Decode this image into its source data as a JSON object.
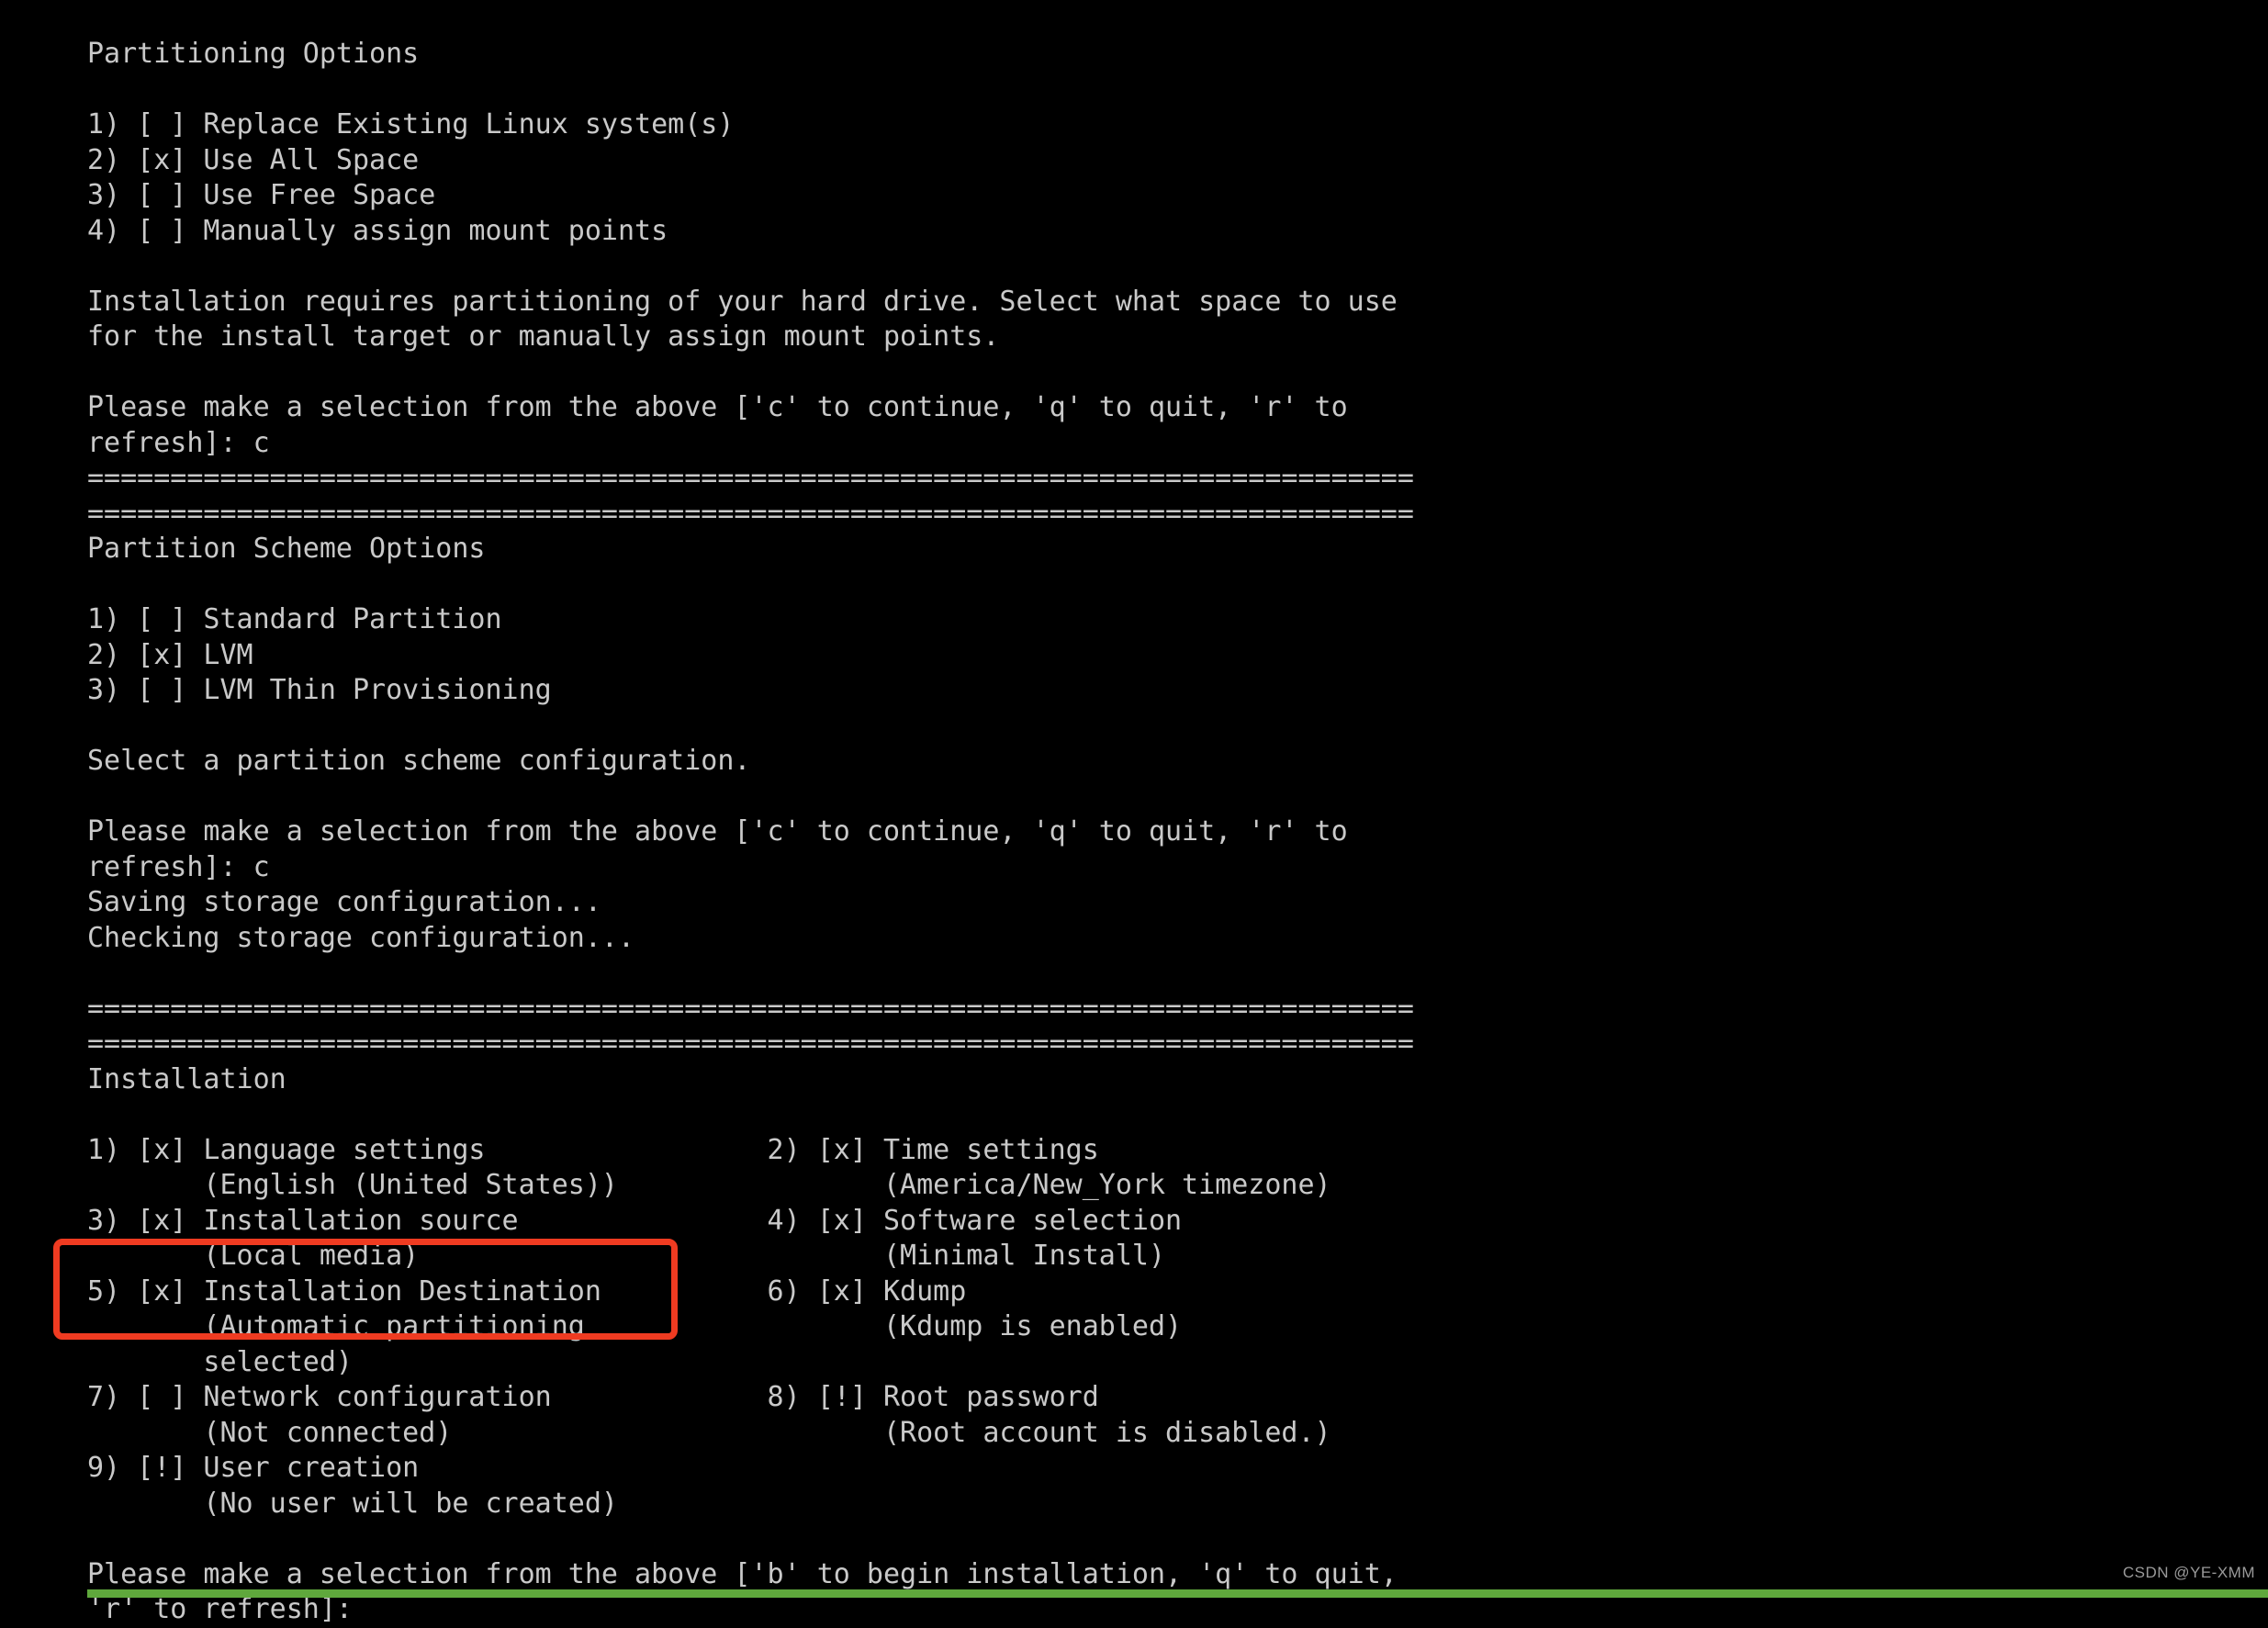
{
  "terminal": {
    "background_color": "#000000",
    "text_color": "#c9c9c9",
    "highlight_color": "#ef3b21",
    "strip_color": "#5fa83c",
    "separator": "================================================================================",
    "lines": [
      "Partitioning Options",
      "",
      "1) [ ] Replace Existing Linux system(s)",
      "2) [x] Use All Space",
      "3) [ ] Use Free Space",
      "4) [ ] Manually assign mount points",
      "",
      "Installation requires partitioning of your hard drive. Select what space to use",
      "for the install target or manually assign mount points.",
      "",
      "Please make a selection from the above ['c' to continue, 'q' to quit, 'r' to",
      "refresh]: c",
      "================================================================================",
      "================================================================================",
      "Partition Scheme Options",
      "",
      "1) [ ] Standard Partition",
      "2) [x] LVM",
      "3) [ ] LVM Thin Provisioning",
      "",
      "Select a partition scheme configuration.",
      "",
      "Please make a selection from the above ['c' to continue, 'q' to quit, 'r' to",
      "refresh]: c",
      "Saving storage configuration...",
      "Checking storage configuration...",
      "",
      "================================================================================",
      "================================================================================",
      "Installation",
      "",
      "1) [x] Language settings                 2) [x] Time settings",
      "       (English (United States))                (America/New_York timezone)",
      "3) [x] Installation source               4) [x] Software selection",
      "       (Local media)                            (Minimal Install)",
      "5) [x] Installation Destination          6) [x] Kdump",
      "       (Automatic partitioning                  (Kdump is enabled)",
      "       selected)",
      "7) [ ] Network configuration             8) [!] Root password",
      "       (Not connected)                          (Root account is disabled.)",
      "9) [!] User creation",
      "       (No user will be created)",
      "",
      "Please make a selection from the above ['b' to begin installation, 'q' to quit,",
      "'r' to refresh]:"
    ]
  },
  "sections": {
    "partitioning_options": {
      "title": "Partitioning Options",
      "description_line_1": "Installation requires partitioning of your hard drive. Select what space to use",
      "description_line_2": "for the install target or manually assign mount points.",
      "prompt_line_1": "Please make a selection from the above ['c' to continue, 'q' to quit, 'r' to",
      "prompt_line_2": "refresh]: c",
      "items": [
        {
          "number": "1)",
          "marker": "[ ]",
          "label": "Replace Existing Linux system(s)",
          "selected": false
        },
        {
          "number": "2)",
          "marker": "[x]",
          "label": "Use All Space",
          "selected": true
        },
        {
          "number": "3)",
          "marker": "[ ]",
          "label": "Use Free Space",
          "selected": false
        },
        {
          "number": "4)",
          "marker": "[ ]",
          "label": "Manually assign mount points",
          "selected": false
        }
      ]
    },
    "partition_scheme_options": {
      "title": "Partition Scheme Options",
      "description": "Select a partition scheme configuration.",
      "prompt_line_1": "Please make a selection from the above ['c' to continue, 'q' to quit, 'r' to",
      "prompt_line_2": "refresh]: c",
      "status_1": "Saving storage configuration...",
      "status_2": "Checking storage configuration...",
      "items": [
        {
          "number": "1)",
          "marker": "[ ]",
          "label": "Standard Partition",
          "selected": false
        },
        {
          "number": "2)",
          "marker": "[x]",
          "label": "LVM",
          "selected": true
        },
        {
          "number": "3)",
          "marker": "[ ]",
          "label": "LVM Thin Provisioning",
          "selected": false
        }
      ]
    },
    "installation": {
      "title": "Installation",
      "prompt_line_1": "Please make a selection from the above ['b' to begin installation, 'q' to quit,",
      "prompt_line_2": "'r' to refresh]:",
      "items": [
        {
          "number": "1)",
          "marker": "[x]",
          "label": "Language settings",
          "status": "(English (United States))",
          "highlighted": false
        },
        {
          "number": "2)",
          "marker": "[x]",
          "label": "Time settings",
          "status": "(America/New_York timezone)",
          "highlighted": false
        },
        {
          "number": "3)",
          "marker": "[x]",
          "label": "Installation source",
          "status": "(Local media)",
          "highlighted": false
        },
        {
          "number": "4)",
          "marker": "[x]",
          "label": "Software selection",
          "status": "(Minimal Install)",
          "highlighted": false
        },
        {
          "number": "5)",
          "marker": "[x]",
          "label": "Installation Destination",
          "status": "(Automatic partitioning selected)",
          "highlighted": true
        },
        {
          "number": "6)",
          "marker": "[x]",
          "label": "Kdump",
          "status": "(Kdump is enabled)",
          "highlighted": false
        },
        {
          "number": "7)",
          "marker": "[ ]",
          "label": "Network configuration",
          "status": "(Not connected)",
          "highlighted": false
        },
        {
          "number": "8)",
          "marker": "[!]",
          "label": "Root password",
          "status": "(Root account is disabled.)",
          "highlighted": false
        },
        {
          "number": "9)",
          "marker": "[!]",
          "label": "User creation",
          "status": "(No user will be created)",
          "highlighted": false
        }
      ]
    }
  },
  "watermark": {
    "text": "CSDN @YE-XMM"
  }
}
